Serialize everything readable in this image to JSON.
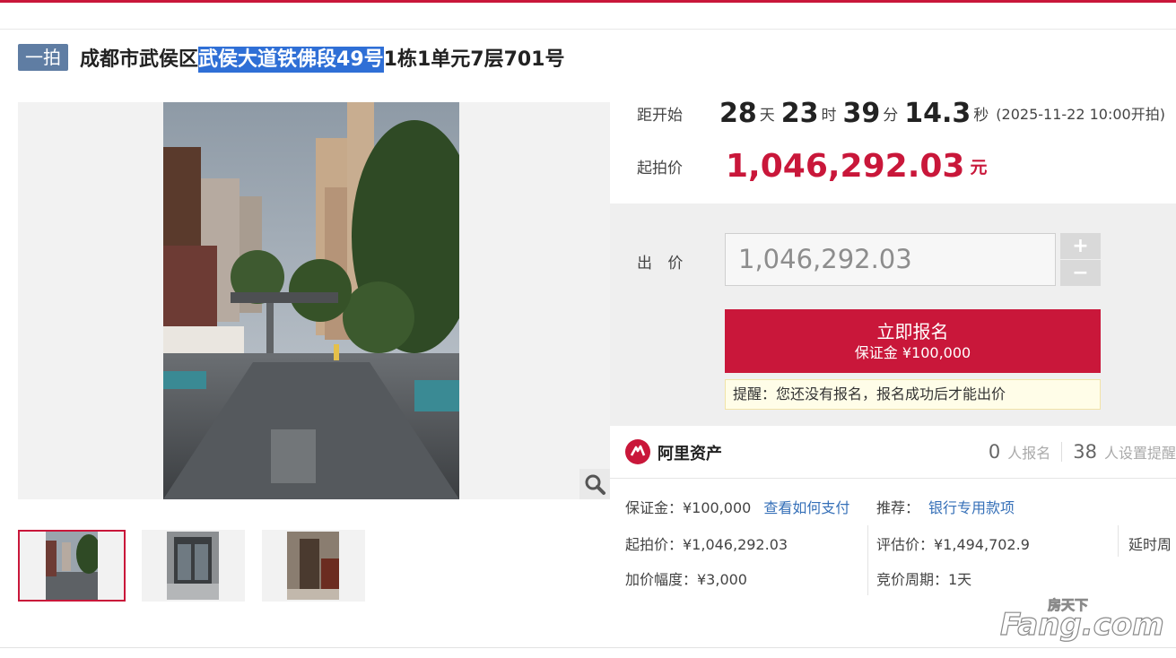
{
  "header": {
    "badge": "一拍",
    "title_prefix": "成都市武侯区",
    "title_highlight": "武侯大道铁佛段49号",
    "title_suffix": "1栋1单元7层701号"
  },
  "countdown": {
    "label": "距开始",
    "days": "28",
    "days_unit": "天",
    "hours": "23",
    "hours_unit": "时",
    "minutes": "39",
    "minutes_unit": "分",
    "seconds": "14.3",
    "seconds_unit": "秒",
    "start_note": "(2025-11-22 10:00开拍)"
  },
  "starting_price": {
    "label": "起拍价",
    "value": "1,046,292.03",
    "unit": "元"
  },
  "bid": {
    "label": "出 价",
    "input_value": "1,046,292.03",
    "plus": "+",
    "minus": "−",
    "signup_label": "立即报名",
    "deposit_label": "保证金 ¥100,000",
    "reminder": "提醒：您还没有报名，报名成功后才能出价"
  },
  "platform": {
    "name": "阿里资产",
    "registered_count": "0",
    "registered_label": "人报名",
    "reminder_count": "38",
    "reminder_label": "人设置提醒"
  },
  "details": {
    "deposit": "保证金：¥100,000",
    "how_to_pay": "查看如何支付",
    "recommend_label": "推荐：",
    "recommend_link": "银行专用款项",
    "start_price": "起拍价：¥1,046,292.03",
    "appraisal": "评估价：¥1,494,702.9",
    "delay": "延时周",
    "increment": "加价幅度：¥3,000",
    "cycle": "竞价周期：1天"
  },
  "watermark": {
    "text_cn": "房天下",
    "text_en": "Fang.com"
  },
  "colors": {
    "accent": "#c9173a",
    "badge": "#5f7da3",
    "link": "#3670b8",
    "highlight": "#2f6fd6"
  },
  "icons": [
    "search-icon",
    "plus-icon",
    "minus-icon",
    "ali-asset-logo"
  ]
}
